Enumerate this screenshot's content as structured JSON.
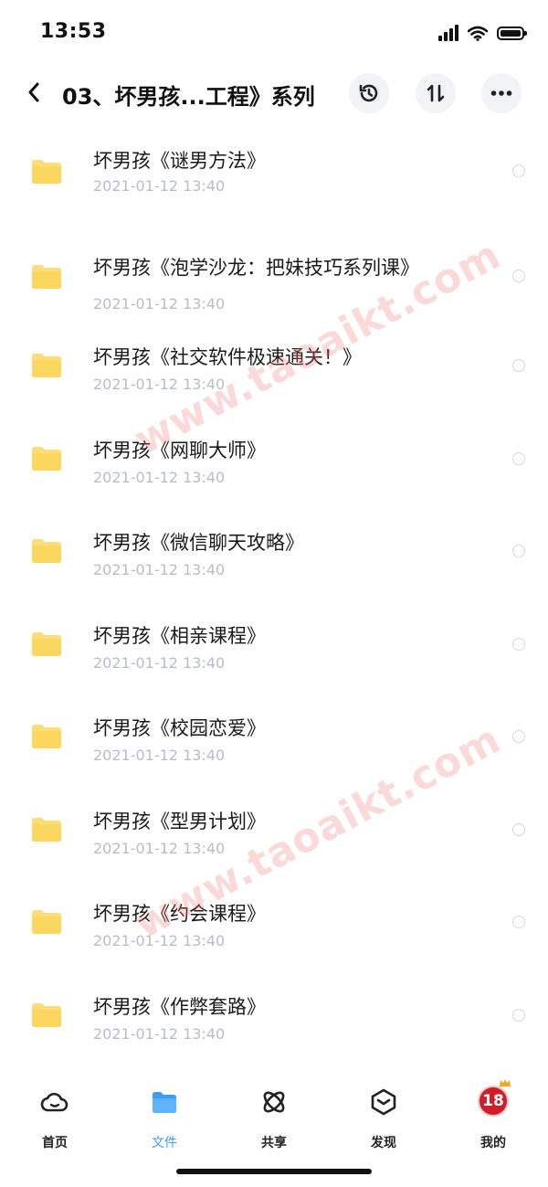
{
  "status_bar": {
    "time": "13:53"
  },
  "header": {
    "title": "03、坏男孩...工程》系列"
  },
  "icons": {
    "back": "chevron-left-icon",
    "history": "history-icon",
    "sort": "sort-icon",
    "more": "more-icon",
    "folder": "folder-icon"
  },
  "files": [
    {
      "name": "坏男孩《谜男方法》",
      "date": "2021-01-12 13:40"
    },
    {
      "name": "坏男孩《泡学沙龙：把妹技巧系列课》",
      "date": "2021-01-12 13:40"
    },
    {
      "name": "坏男孩《社交软件极速通关！》",
      "date": "2021-01-12 13:40"
    },
    {
      "name": "坏男孩《网聊大师》",
      "date": "2021-01-12 13:40"
    },
    {
      "name": "坏男孩《微信聊天攻略》",
      "date": "2021-01-12 13:40"
    },
    {
      "name": "坏男孩《相亲课程》",
      "date": "2021-01-12 13:40"
    },
    {
      "name": "坏男孩《校园恋爱》",
      "date": "2021-01-12 13:40"
    },
    {
      "name": "坏男孩《型男计划》",
      "date": "2021-01-12 13:40"
    },
    {
      "name": "坏男孩《约会课程》",
      "date": "2021-01-12 13:40"
    },
    {
      "name": "坏男孩《作弊套路》",
      "date": "2021-01-12 13:40"
    }
  ],
  "watermarks": [
    "www.taoaikt.com",
    "www.taoaikt.com"
  ],
  "tabs": [
    {
      "label": "首页",
      "icon": "cloud-icon",
      "active": false
    },
    {
      "label": "文件",
      "icon": "folder-icon",
      "active": true
    },
    {
      "label": "共享",
      "icon": "atom-icon",
      "active": false
    },
    {
      "label": "发现",
      "icon": "compass-box-icon",
      "active": false
    },
    {
      "label": "我的",
      "icon": "avatar",
      "avatar_text": "18",
      "active": false
    }
  ],
  "colors": {
    "folder": "#fcd75f",
    "active_tab": "#3c9cf8",
    "date_text": "#b8bdc6",
    "avatar_bg": "#d01d2a",
    "watermark": "#f07878"
  }
}
